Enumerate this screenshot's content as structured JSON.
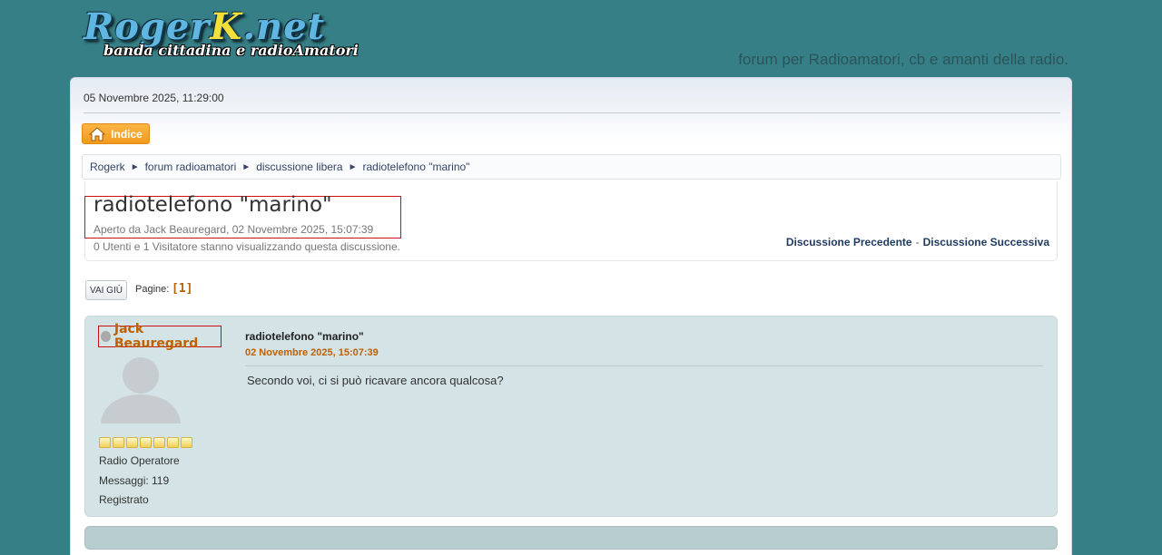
{
  "header": {
    "logo_main_a": "Roger",
    "logo_main_k": "K",
    "logo_main_b": ".net",
    "logo_subtitle": "banda cittadina e radioAmatori",
    "slogan": "forum per Radioamatori, cb e amanti della radio."
  },
  "datetime": "05 Novembre 2025, 11:29:00",
  "nav": {
    "home_label": "Indice"
  },
  "breadcrumb": {
    "items": [
      "Rogerk",
      "forum radioamatori",
      "discussione libera",
      "radiotelefono \"marino\""
    ],
    "separator": "►"
  },
  "topic": {
    "title": "radiotelefono \"marino\"",
    "started_by": "Aperto da Jack Beauregard, 02 Novembre 2025, 15:07:39",
    "viewers": "0 Utenti e 1 Visitatore stanno visualizzando questa discussione.",
    "prev_label": "Discussione Precedente",
    "dash": "-",
    "next_label": "Discussione Successiva"
  },
  "pagination": {
    "goto_label": "VAI GIÙ",
    "pages_label": "Pagine:",
    "current_page": "[1]"
  },
  "post": {
    "author": "Jack Beauregard",
    "rank": "Radio Operatore",
    "messages": "Messaggi: 119",
    "registered": "Registrato",
    "subject": "radiotelefono \"marino\"",
    "date": "02 Novembre 2025, 15:07:39",
    "body": "Secondo voi, ci si può ricavare ancora qualcosa?",
    "star_count": 7,
    "status_icon": "offline-dot-icon"
  },
  "colors": {
    "background": "#367f86",
    "accent_orange": "#c06000",
    "post_bg": "#d3e3e6",
    "home_button": "#f29a1d",
    "highlight_border": "#cc1010"
  }
}
